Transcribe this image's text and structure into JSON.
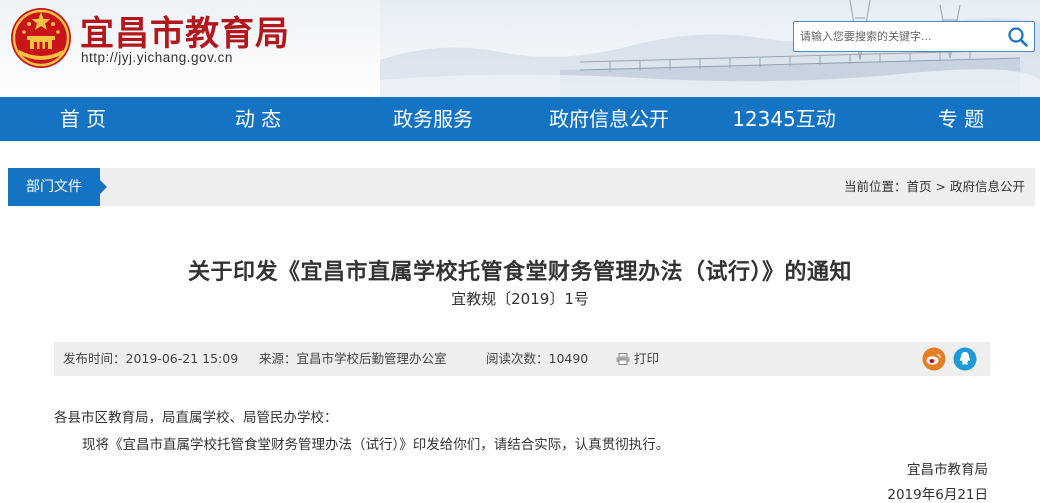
{
  "header": {
    "site_title": "宜昌市教育局",
    "site_url": "http://jyj.yichang.gov.cn",
    "search": {
      "placeholder": "请输入您要搜索的关键字..."
    }
  },
  "nav": {
    "items": [
      {
        "label": "首 页"
      },
      {
        "label": "动 态"
      },
      {
        "label": "政务服务"
      },
      {
        "label": "政府信息公开"
      },
      {
        "label": "12345互动"
      },
      {
        "label": "专 题"
      }
    ]
  },
  "section": {
    "tab_label": "部门文件",
    "breadcrumb": {
      "prefix": "当前位置：",
      "home": "首页",
      "separator": ">",
      "current": "政府信息公开"
    }
  },
  "article": {
    "title": "关于印发《宜昌市直属学校托管食堂财务管理办法（试行）》的通知",
    "doc_number": "宜教规〔2019〕1号",
    "meta": {
      "publish_time": "发布时间：2019-06-21 15:09",
      "source": "来源：宜昌市学校后勤管理办公室",
      "views": "阅读次数：10490",
      "print_label": "打印"
    },
    "salutation": "各县市区教育局，局直属学校、局管民办学校：",
    "paragraph": "现将《宜昌市直属学校托管食堂财务管理办法（试行）》印发给你们，请结合实际，认真贯彻执行。",
    "signature": "宜昌市教育局",
    "date": "2019年6月21日"
  },
  "colors": {
    "brand_red": "#b3161b",
    "nav_blue": "#1573c4",
    "weibo_orange": "#e6162d",
    "qq_blue": "#1d9bd8"
  },
  "icons": {
    "emblem": "national-emblem",
    "search": "search-icon",
    "print": "printer-icon",
    "weibo": "weibo-icon",
    "qq": "qq-icon"
  }
}
